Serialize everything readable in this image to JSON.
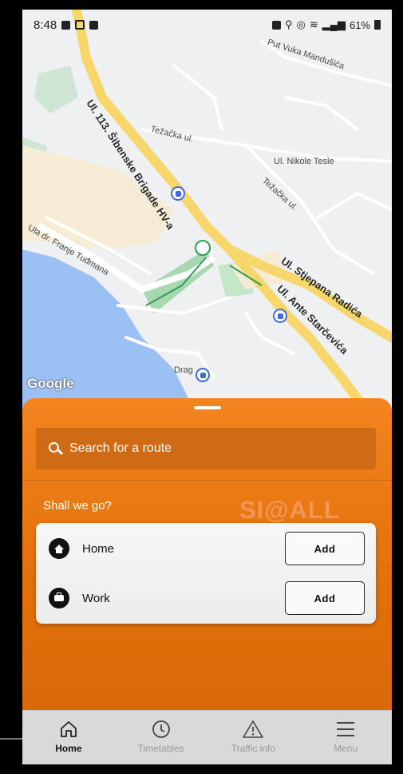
{
  "status_bar": {
    "time": "8:48",
    "battery": "61%"
  },
  "map": {
    "labels": {
      "street_1": "Ul. 113. Šibenske Brigade HV-a",
      "street_2": "Težačka ul.",
      "street_3": "Ul. Nikole Tesle",
      "street_4": "Težačka ul.",
      "street_5": "Put Vuka Mandušića",
      "street_6": "Ul. Stjepana Radića",
      "street_7": "Ul. Ante Starčevića",
      "street_8": "Ula dr. Franje Tuđmana",
      "street_9": "Drag"
    },
    "google_logo": "Google"
  },
  "sheet": {
    "search_placeholder": "Search for a route",
    "section_title": "Shall we go?",
    "watermark": "SI@ALL",
    "saved_places": [
      {
        "label": "Home",
        "icon": "home-icon",
        "button": "Add"
      },
      {
        "label": "Work",
        "icon": "briefcase-icon",
        "button": "Add"
      }
    ]
  },
  "nav": [
    {
      "label": "Home",
      "icon": "home-icon",
      "active": true
    },
    {
      "label": "Timetables",
      "icon": "clock-icon",
      "active": false
    },
    {
      "label": "Traffic info",
      "icon": "warning-icon",
      "active": false
    },
    {
      "label": "Menu",
      "icon": "menu-icon",
      "active": false
    }
  ],
  "colors": {
    "accent": "#f3841f",
    "map_water": "#9bc0f3",
    "map_road": "#f7d76b"
  }
}
